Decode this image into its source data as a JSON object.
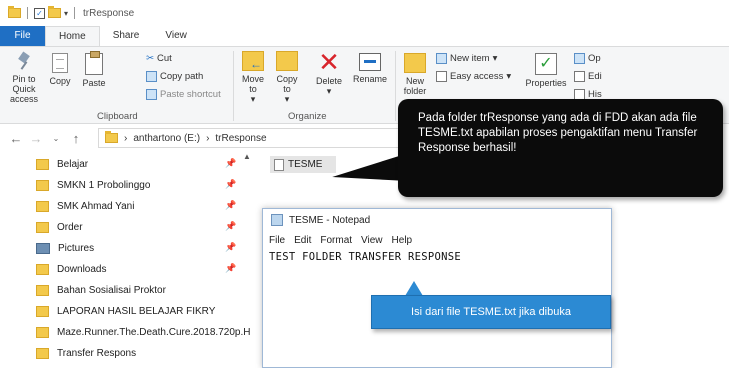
{
  "titlebar": {
    "title": "trResponse"
  },
  "tabs": [
    {
      "label": "File"
    },
    {
      "label": "Home"
    },
    {
      "label": "Share"
    },
    {
      "label": "View"
    }
  ],
  "ribbon": {
    "clipboard": {
      "pin_label": "Pin to Quick access",
      "copy_label": "Copy",
      "paste_label": "Paste",
      "cut_label": "Cut",
      "copy_path_label": "Copy path",
      "paste_shortcut_label": "Paste shortcut",
      "group_label": "Clipboard"
    },
    "organize": {
      "move_to_label": "Move to",
      "copy_to_label": "Copy to",
      "delete_label": "Delete",
      "rename_label": "Rename",
      "group_label": "Organize"
    },
    "new": {
      "new_folder_label": "New folder",
      "new_item_label": "New item",
      "easy_access_label": "Easy access"
    },
    "open": {
      "properties_label": "Properties",
      "open_label": "Op",
      "edit_label": "Edi",
      "history_label": "His"
    }
  },
  "address": {
    "crumbs": [
      "anthartono (E:)",
      "trResponse"
    ]
  },
  "nav_pane": {
    "items": [
      {
        "label": "Belajar",
        "pinned": true
      },
      {
        "label": "SMKN 1 Probolinggo",
        "pinned": true
      },
      {
        "label": "SMK Ahmad Yani",
        "pinned": true
      },
      {
        "label": "Order",
        "pinned": true
      },
      {
        "label": "Pictures",
        "pinned": true
      },
      {
        "label": "Downloads",
        "pinned": true
      },
      {
        "label": "Bahan Sosialisai Proktor",
        "pinned": false
      },
      {
        "label": "LAPORAN HASIL BELAJAR FIKRY",
        "pinned": false
      },
      {
        "label": "Maze.Runner.The.Death.Cure.2018.720p.H",
        "pinned": false
      },
      {
        "label": "Transfer Respons",
        "pinned": false
      }
    ]
  },
  "file_list": {
    "files": [
      {
        "name": "TESME"
      }
    ]
  },
  "notepad": {
    "title": "TESME - Notepad",
    "menu": [
      "File",
      "Edit",
      "Format",
      "View",
      "Help"
    ],
    "content": "TEST FOLDER TRANSFER RESPONSE"
  },
  "callouts": {
    "dark_text": "Pada folder trResponse yang ada di FDD akan ada file TESME.txt apabilan proses pengaktifan menu Transfer Response berhasil!",
    "blue_text": "Isi dari file TESME.txt jika dibuka"
  },
  "colors": {
    "file_tab": "#1f6fc4",
    "folder": "#f3c94b",
    "delete": "#d8252c",
    "callout_blue": "#2c8ad3",
    "callout_dark": "#0b0b0b"
  }
}
